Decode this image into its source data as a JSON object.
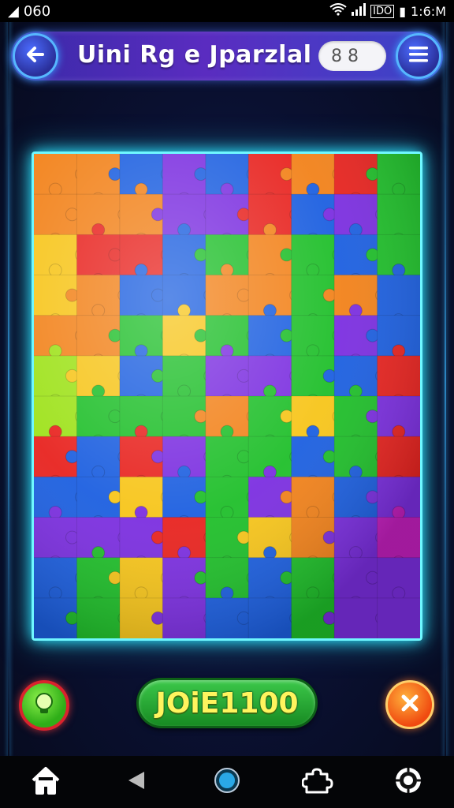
{
  "status_bar": {
    "left_text": "060",
    "time": "1:6:M",
    "net_label": "IDO"
  },
  "header": {
    "title": "Uini Rg e Jparzlal",
    "search_glyph": "8 8",
    "back_icon": "arrow-left-icon",
    "menu_icon": "hamburger-icon"
  },
  "board": {
    "rows": 12,
    "cols": 9,
    "frame_color": "#6ff7ff",
    "palette": {
      "R": "#e8231f",
      "O": "#f2821a",
      "Y": "#f7c51a",
      "L": "#9ee21a",
      "G": "#1fbf2a",
      "B": "#1c5fe0",
      "P": "#7b2ee0",
      "M": "#c41fbe",
      "C": "#21a7e6"
    },
    "grid": [
      "OOBPBRORG",
      "OOOPPRBPG",
      "YRRBGOGBG",
      "YOBBOOGOB",
      "OOGYGBGPB",
      "LYBGPPGBR",
      "LGGGOGYGP",
      "RBRPGGBGR",
      "BBYBGPOBP",
      "PPPRGYOPM",
      "BGYPGBGPP",
      "BGYPBBGPP"
    ]
  },
  "actions": {
    "score_text": "JOiE1100",
    "hint_icon": "lightbulb-icon",
    "close_icon": "close-icon"
  },
  "nav": {
    "items": [
      "home-icon",
      "back-triangle-icon",
      "circle-home-icon",
      "puzzle-icon",
      "settings-gear-icon"
    ]
  }
}
